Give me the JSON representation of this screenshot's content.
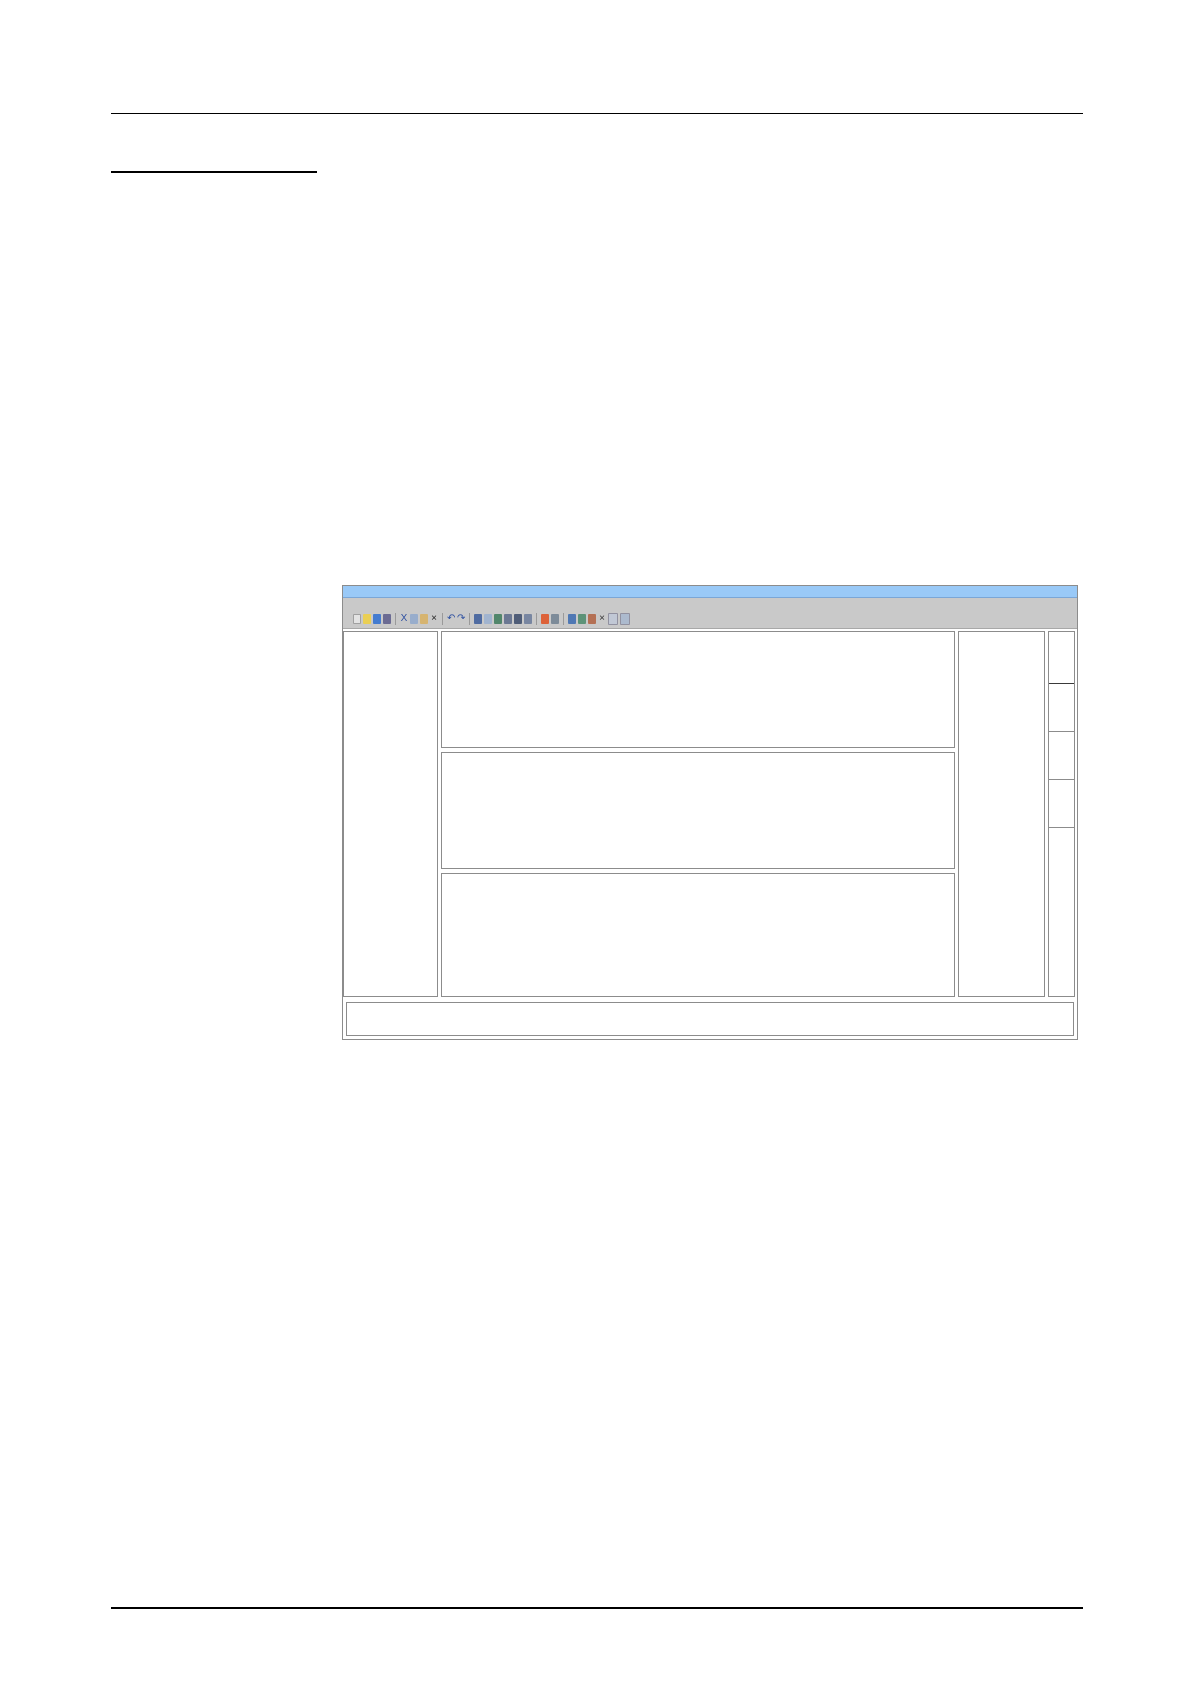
{
  "document": {
    "header_rule": true,
    "footer_rule": true
  },
  "app_window": {
    "title": "",
    "colors": {
      "title_bar": "#99c9f7",
      "toolbar": "#c9c9c9",
      "border": "#8c8c8c"
    },
    "toolbar_icons": [
      "new-document-icon",
      "open-icon",
      "save-icon",
      "print-icon",
      "cut-icon",
      "copy-icon",
      "paste-icon",
      "delete-icon",
      "undo-icon",
      "redo-icon",
      "calculator-icon",
      "search-icon",
      "table-icon",
      "list-icon",
      "grid-icon",
      "image-icon",
      "pencil-icon",
      "brush-icon",
      "chart-icon",
      "layout-icon",
      "template-icon",
      "close-icon",
      "window-icon",
      "panel-icon"
    ],
    "panes": {
      "left": "",
      "editors": [
        "",
        "",
        ""
      ],
      "right": "",
      "side_strip_cells": 5,
      "status": ""
    }
  }
}
